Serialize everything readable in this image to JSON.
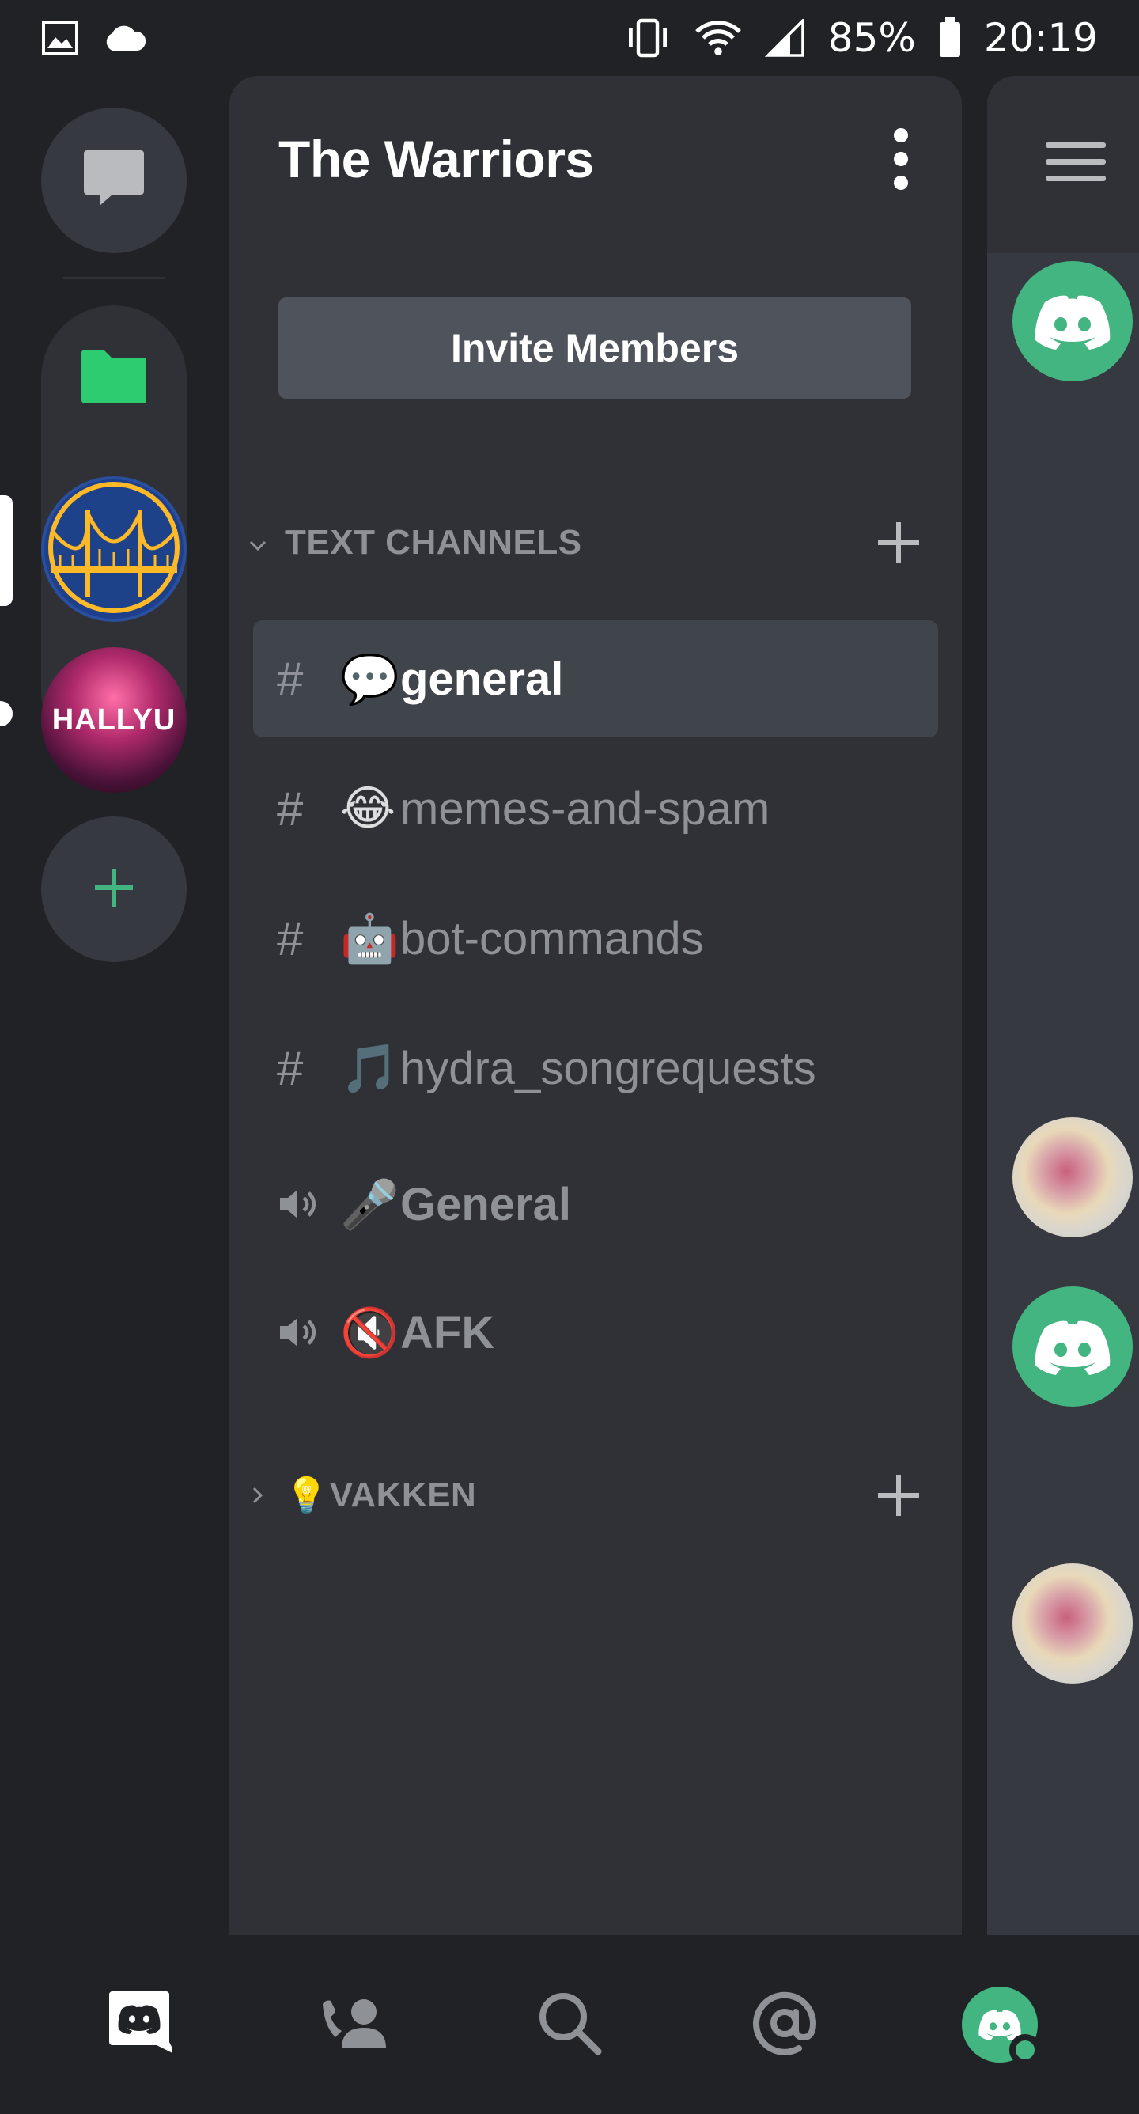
{
  "status_bar": {
    "battery": "85%",
    "time": "20:19",
    "left_icons": [
      "image-icon",
      "cloud-icon"
    ],
    "right_icons": [
      "vibrate-icon",
      "wifi-icon",
      "signal-icon",
      "battery-icon"
    ]
  },
  "server_rail": {
    "servers": [
      {
        "name": "direct-messages",
        "icon": "chat-bubble-icon"
      },
      {
        "name": "folder",
        "icon": "folder-icon",
        "color": "#2ecc71"
      },
      {
        "name": "warriors-server",
        "icon": "golden-gate-logo"
      },
      {
        "name": "hallyu-server",
        "label": "HALLYU"
      },
      {
        "name": "add-server",
        "icon": "plus-icon",
        "color": "#43b581"
      }
    ]
  },
  "server": {
    "title": "The Warriors",
    "invite_label": "Invite Members"
  },
  "categories": [
    {
      "label": "TEXT CHANNELS",
      "expanded": true
    },
    {
      "emoji": "💡",
      "label": "VAKKEN",
      "expanded": false
    }
  ],
  "channels": [
    {
      "type": "text",
      "emoji": "💬",
      "name": "general",
      "selected": true
    },
    {
      "type": "text",
      "emoji": "😂",
      "name": "memes-and-spam",
      "selected": false
    },
    {
      "type": "text",
      "emoji": "🤖",
      "name": "bot-commands",
      "selected": false
    },
    {
      "type": "text",
      "emoji": "🎵",
      "name": "hydra_songrequests",
      "selected": false
    },
    {
      "type": "voice",
      "emoji": "🎤",
      "name": "General",
      "selected": false
    },
    {
      "type": "voice",
      "emoji": "🔇",
      "name": "AFK",
      "selected": false
    }
  ],
  "prefix": {
    "text": "#"
  },
  "colors": {
    "background": "#202225",
    "panel": "#2f3136",
    "chat": "#36393f",
    "selected": "#40444b",
    "button": "#4f545c",
    "muted_text": "#8e9297",
    "green": "#43b581"
  },
  "bottom_nav": [
    {
      "name": "home",
      "icon": "discord-logo-icon",
      "active": true
    },
    {
      "name": "friends",
      "icon": "friends-icon"
    },
    {
      "name": "search",
      "icon": "search-icon"
    },
    {
      "name": "mentions",
      "icon": "at-icon"
    },
    {
      "name": "profile",
      "icon": "avatar-icon",
      "status": "online"
    }
  ]
}
